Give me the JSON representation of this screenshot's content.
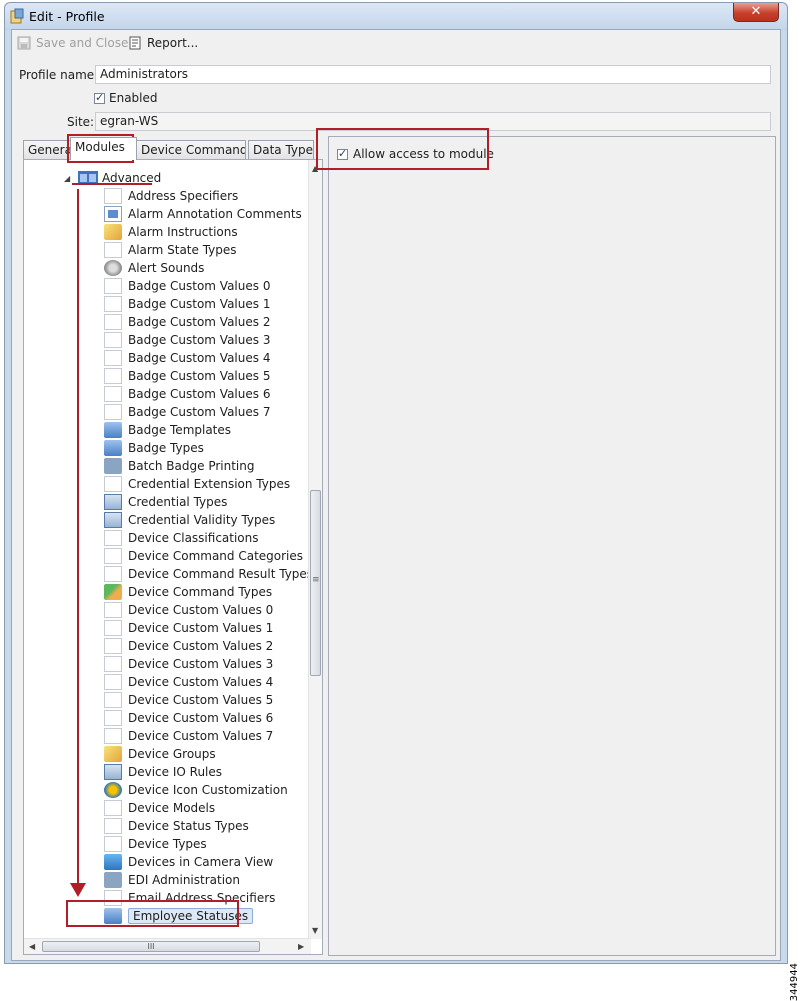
{
  "window": {
    "title": "Edit - Profile",
    "close_symbol": "✕"
  },
  "toolbar": {
    "save_label": "Save and Close",
    "report_label": "Report..."
  },
  "form": {
    "profile_name_label": "Profile name:",
    "profile_name_value": "Administrators",
    "enabled_label": "Enabled",
    "site_label": "Site:",
    "site_value": "egran-WS"
  },
  "tabs": [
    "General",
    "Modules",
    "Device Commands",
    "Data Types"
  ],
  "tree": {
    "root": "Advanced",
    "items": [
      "Address Specifiers",
      "Alarm Annotation Comments",
      "Alarm Instructions",
      "Alarm State Types",
      "Alert Sounds",
      "Badge Custom Values 0",
      "Badge Custom Values 1",
      "Badge Custom Values 2",
      "Badge Custom Values 3",
      "Badge Custom Values 4",
      "Badge Custom Values 5",
      "Badge Custom Values 6",
      "Badge Custom Values 7",
      "Badge Templates",
      "Badge Types",
      "Batch Badge Printing",
      "Credential Extension Types",
      "Credential Types",
      "Credential Validity Types",
      "Device Classifications",
      "Device Command Categories",
      "Device Command Result Types",
      "Device Command Types",
      "Device Custom Values 0",
      "Device Custom Values 1",
      "Device Custom Values 2",
      "Device Custom Values 3",
      "Device Custom Values 4",
      "Device Custom Values 5",
      "Device Custom Values 6",
      "Device Custom Values 7",
      "Device Groups",
      "Device IO Rules",
      "Device Icon Customization",
      "Device Models",
      "Device Status Types",
      "Device Types",
      "Devices in Camera View",
      "EDI Administration",
      "Email Address Specifiers",
      "Employee Statuses"
    ],
    "selected": "Employee Statuses"
  },
  "scroll": {
    "h_grip": "III",
    "v_grip": "≡"
  },
  "module_access": {
    "allow_label": "Allow access to module"
  },
  "figure_id": "344944",
  "colors": {
    "highlight": "#b01e28",
    "selection": "#dce8f6",
    "window_frame": "#c9d9ec"
  }
}
